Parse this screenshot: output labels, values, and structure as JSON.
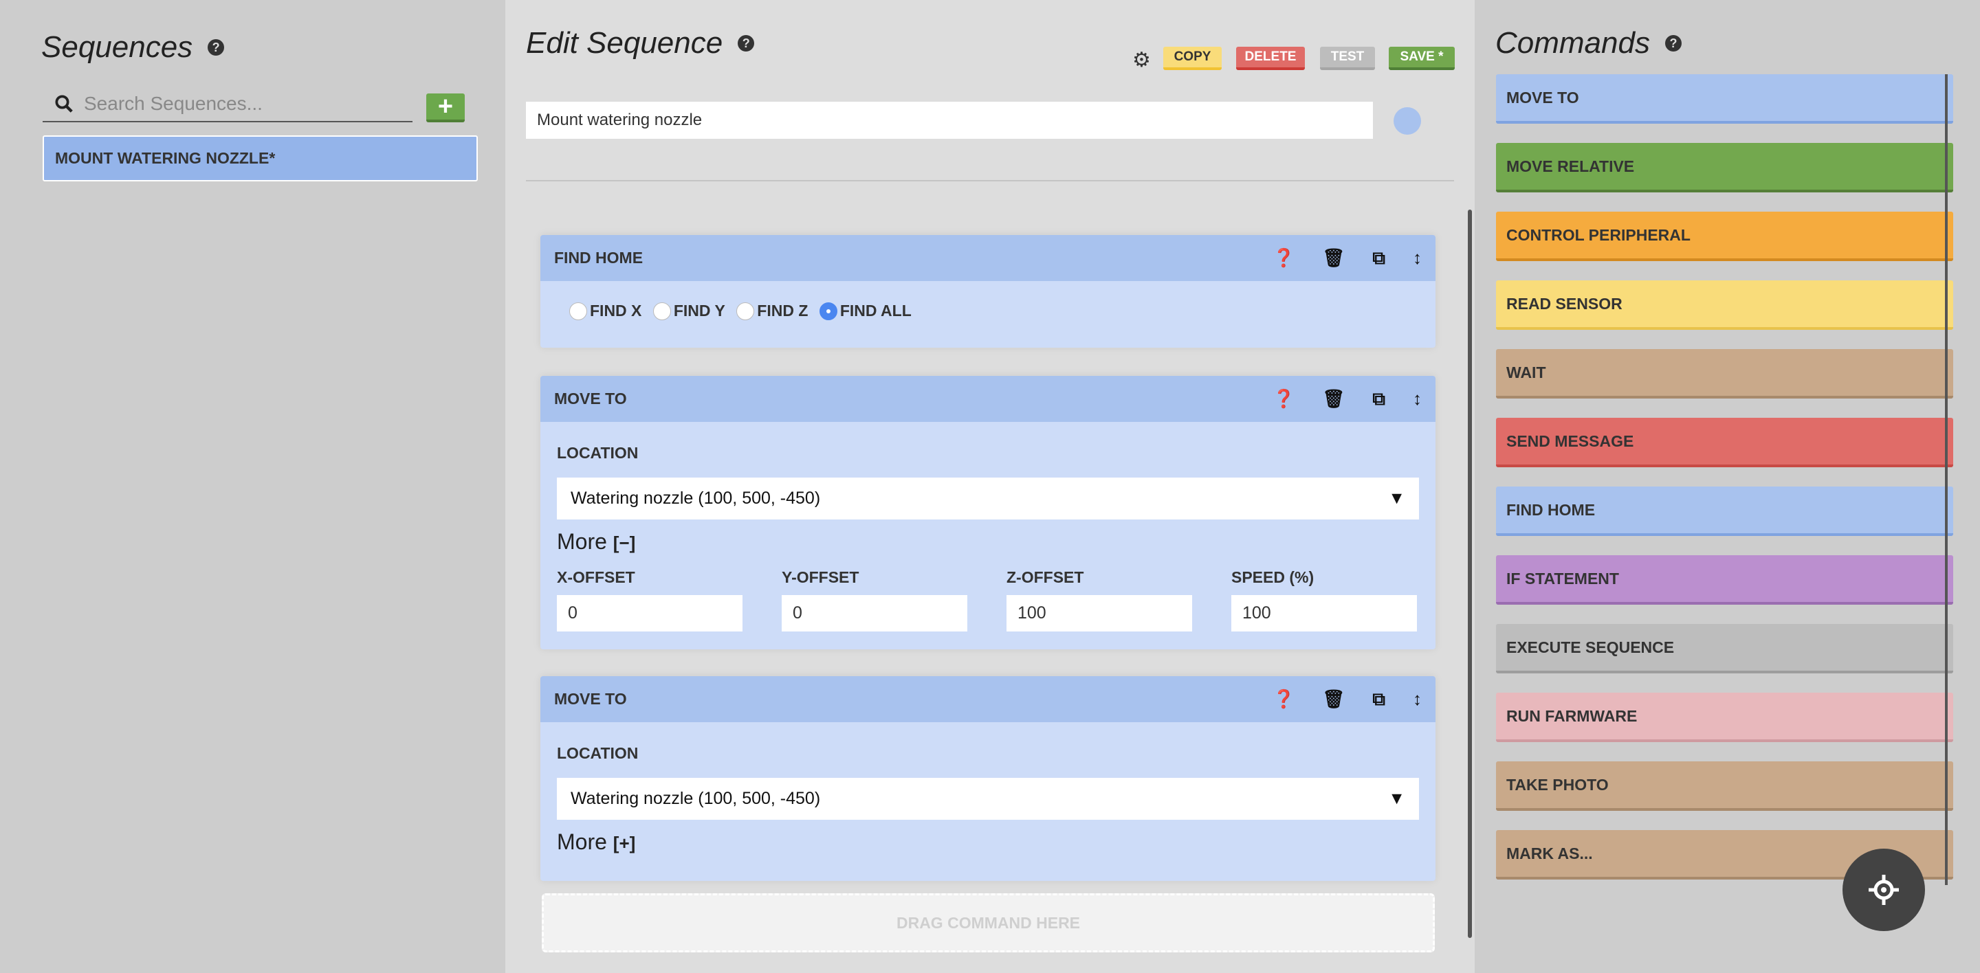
{
  "sequences": {
    "title": "Sequences",
    "search_placeholder": "Search Sequences...",
    "add_label": "+",
    "items": [
      {
        "label": "MOUNT WATERING NOZZLE*"
      }
    ]
  },
  "editor": {
    "title": "Edit Sequence",
    "buttons": {
      "copy": "COPY",
      "delete": "DELETE",
      "test": "TEST",
      "save": "SAVE *"
    },
    "name": "Mount watering nozzle",
    "steps": [
      {
        "title": "FIND HOME",
        "options": [
          "FIND X",
          "FIND Y",
          "FIND Z",
          "FIND ALL"
        ],
        "selected": "FIND ALL"
      },
      {
        "title": "MOVE TO",
        "location_label": "LOCATION",
        "location": "Watering nozzle (100, 500, -450)",
        "more": "More",
        "more_toggle": "[−]",
        "offsets": [
          {
            "label": "X-OFFSET",
            "value": "0"
          },
          {
            "label": "Y-OFFSET",
            "value": "0"
          },
          {
            "label": "Z-OFFSET",
            "value": "100"
          },
          {
            "label": "SPEED (%)",
            "value": "100"
          }
        ]
      },
      {
        "title": "MOVE TO",
        "location_label": "LOCATION",
        "location": "Watering nozzle (100, 500, -450)",
        "more": "More",
        "more_toggle": "[+]"
      }
    ],
    "drop_zone": "DRAG COMMAND HERE"
  },
  "commands": {
    "title": "Commands",
    "items": [
      {
        "label": "MOVE TO",
        "color": "#a8c2ee",
        "border": "#7fa3e0"
      },
      {
        "label": "MOVE RELATIVE",
        "color": "#73a84e",
        "border": "#557f38"
      },
      {
        "label": "CONTROL PERIPHERAL",
        "color": "#f5ab3e",
        "border": "#d38a20"
      },
      {
        "label": "READ SENSOR",
        "color": "#f9dc7a",
        "border": "#e8c34c"
      },
      {
        "label": "WAIT",
        "color": "#c9a98a",
        "border": "#a88a6c"
      },
      {
        "label": "SEND MESSAGE",
        "color": "#e06c68",
        "border": "#c84a45"
      },
      {
        "label": "FIND HOME",
        "color": "#a8c2ee",
        "border": "#7fa3e0"
      },
      {
        "label": "IF STATEMENT",
        "color": "#bb8fcf",
        "border": "#9a6db0"
      },
      {
        "label": "EXECUTE SEQUENCE",
        "color": "#bdbdbd",
        "border": "#9d9d9d"
      },
      {
        "label": "RUN FARMWARE",
        "color": "#e8b8bc",
        "border": "#cf9aa0"
      },
      {
        "label": "TAKE PHOTO",
        "color": "#c9a98a",
        "border": "#a88a6c"
      },
      {
        "label": "MARK AS...",
        "color": "#c9a98a",
        "border": "#a88a6c"
      }
    ]
  }
}
